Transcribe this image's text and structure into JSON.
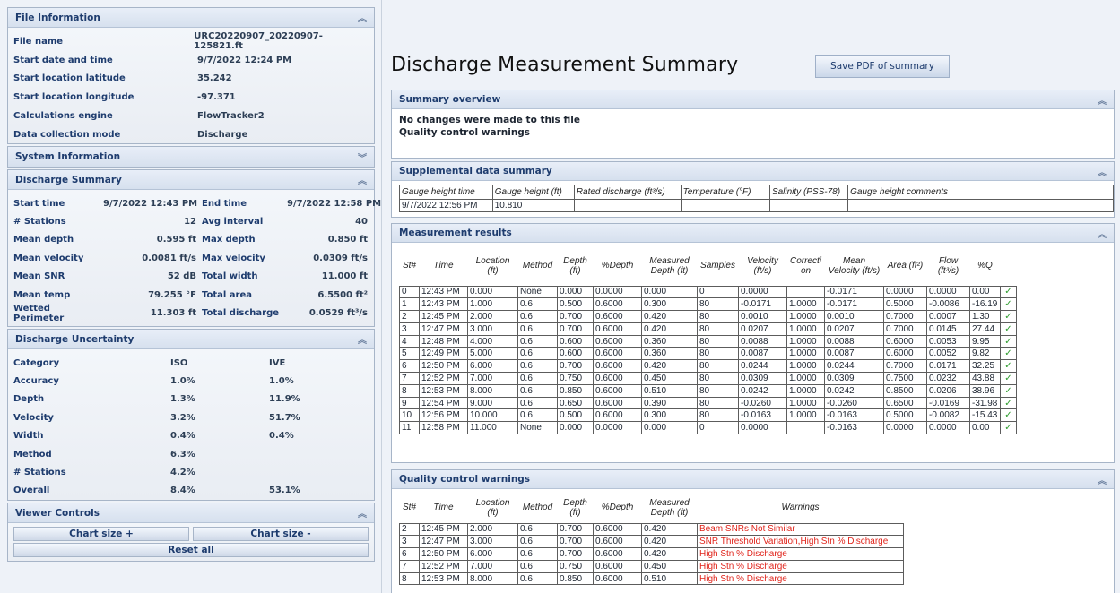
{
  "file_info": {
    "title": "File Information",
    "rows": [
      {
        "label": "File name",
        "value": "URC20220907_20220907-125821.ft"
      },
      {
        "label": "Start date and time",
        "value": "9/7/2022 12:24 PM"
      },
      {
        "label": "Start location latitude",
        "value": "35.242"
      },
      {
        "label": "Start location longitude",
        "value": "-97.371"
      },
      {
        "label": "Calculations engine",
        "value": "FlowTracker2"
      },
      {
        "label": "Data collection mode",
        "value": "Discharge"
      }
    ]
  },
  "system_info": {
    "title": "System Information"
  },
  "discharge_summary": {
    "title": "Discharge Summary",
    "rows": [
      {
        "l1": "Start time",
        "v1": "9/7/2022 12:43 PM",
        "l2": "End time",
        "v2": "9/7/2022 12:58 PM"
      },
      {
        "l1": "# Stations",
        "v1": "12",
        "l2": "Avg interval",
        "v2": "40"
      },
      {
        "l1": "Mean depth",
        "v1": "0.595  ft",
        "l2": "Max depth",
        "v2": "0.850  ft"
      },
      {
        "l1": "Mean velocity",
        "v1": "0.0081  ft/s",
        "l2": "Max velocity",
        "v2": "0.0309  ft/s"
      },
      {
        "l1": "Mean SNR",
        "v1": "52  dB",
        "l2": "Total width",
        "v2": "11.000  ft"
      },
      {
        "l1": "Mean temp",
        "v1": "79.255  °F",
        "l2": "Total area",
        "v2": "6.5500  ft²"
      },
      {
        "l1": "Wetted Perimeter",
        "v1": "11.303  ft",
        "l2": "Total discharge",
        "v2": "0.0529  ft³/s"
      }
    ]
  },
  "uncertainty": {
    "title": "Discharge Uncertainty",
    "header": {
      "c1": "Category",
      "c2": "ISO",
      "c3": "IVE"
    },
    "rows": [
      {
        "c1": "Accuracy",
        "c2": "1.0%",
        "c3": "1.0%"
      },
      {
        "c1": "Depth",
        "c2": "1.3%",
        "c3": "11.9%"
      },
      {
        "c1": "Velocity",
        "c2": "3.2%",
        "c3": "51.7%"
      },
      {
        "c1": "Width",
        "c2": "0.4%",
        "c3": "0.4%"
      },
      {
        "c1": "Method",
        "c2": "6.3%",
        "c3": ""
      },
      {
        "c1": "# Stations",
        "c2": "4.2%",
        "c3": ""
      },
      {
        "c1": "Overall",
        "c2": "8.4%",
        "c3": "53.1%"
      }
    ]
  },
  "viewer_controls": {
    "title": "Viewer Controls",
    "chart_size_plus": "Chart size +",
    "chart_size_minus": "Chart size -",
    "reset_all": "Reset all"
  },
  "main": {
    "title": "Discharge Measurement Summary",
    "save_pdf": "Save PDF of summary"
  },
  "summary_overview": {
    "title": "Summary overview",
    "lines": [
      "No changes were made to this file",
      "Quality control warnings"
    ]
  },
  "supplemental": {
    "title": "Supplemental data summary",
    "headers": [
      "Gauge height time",
      "Gauge height (ft)",
      "Rated discharge (ft³/s)",
      "Temperature (°F)",
      "Salinity (PSS-78)",
      "Gauge height comments"
    ],
    "row": [
      "9/7/2022 12:56 PM",
      "10.810",
      "",
      "",
      "",
      ""
    ]
  },
  "measurement": {
    "title": "Measurement results",
    "headers": [
      "St#",
      "Time",
      "Location (ft)",
      "Method",
      "Depth (ft)",
      "%Depth",
      "Measured Depth (ft)",
      "Samples",
      "Velocity (ft/s)",
      "Correcti on",
      "Mean Velocity (ft/s)",
      "Area (ft²)",
      "Flow (ft³/s)",
      "%Q"
    ],
    "check": "✓",
    "rows": [
      [
        "0",
        "12:43 PM",
        "0.000",
        "None",
        "0.000",
        "0.0000",
        "0.000",
        "0",
        "0.0000",
        "",
        "-0.0171",
        "0.0000",
        "0.0000",
        "0.00"
      ],
      [
        "1",
        "12:43 PM",
        "1.000",
        "0.6",
        "0.500",
        "0.6000",
        "0.300",
        "80",
        "-0.0171",
        "1.0000",
        "-0.0171",
        "0.5000",
        "-0.0086",
        "-16.19"
      ],
      [
        "2",
        "12:45 PM",
        "2.000",
        "0.6",
        "0.700",
        "0.6000",
        "0.420",
        "80",
        "0.0010",
        "1.0000",
        "0.0010",
        "0.7000",
        "0.0007",
        "1.30"
      ],
      [
        "3",
        "12:47 PM",
        "3.000",
        "0.6",
        "0.700",
        "0.6000",
        "0.420",
        "80",
        "0.0207",
        "1.0000",
        "0.0207",
        "0.7000",
        "0.0145",
        "27.44"
      ],
      [
        "4",
        "12:48 PM",
        "4.000",
        "0.6",
        "0.600",
        "0.6000",
        "0.360",
        "80",
        "0.0088",
        "1.0000",
        "0.0088",
        "0.6000",
        "0.0053",
        "9.95"
      ],
      [
        "5",
        "12:49 PM",
        "5.000",
        "0.6",
        "0.600",
        "0.6000",
        "0.360",
        "80",
        "0.0087",
        "1.0000",
        "0.0087",
        "0.6000",
        "0.0052",
        "9.82"
      ],
      [
        "6",
        "12:50 PM",
        "6.000",
        "0.6",
        "0.700",
        "0.6000",
        "0.420",
        "80",
        "0.0244",
        "1.0000",
        "0.0244",
        "0.7000",
        "0.0171",
        "32.25"
      ],
      [
        "7",
        "12:52 PM",
        "7.000",
        "0.6",
        "0.750",
        "0.6000",
        "0.450",
        "80",
        "0.0309",
        "1.0000",
        "0.0309",
        "0.7500",
        "0.0232",
        "43.88"
      ],
      [
        "8",
        "12:53 PM",
        "8.000",
        "0.6",
        "0.850",
        "0.6000",
        "0.510",
        "80",
        "0.0242",
        "1.0000",
        "0.0242",
        "0.8500",
        "0.0206",
        "38.96"
      ],
      [
        "9",
        "12:54 PM",
        "9.000",
        "0.6",
        "0.650",
        "0.6000",
        "0.390",
        "80",
        "-0.0260",
        "1.0000",
        "-0.0260",
        "0.6500",
        "-0.0169",
        "-31.98"
      ],
      [
        "10",
        "12:56 PM",
        "10.000",
        "0.6",
        "0.500",
        "0.6000",
        "0.300",
        "80",
        "-0.0163",
        "1.0000",
        "-0.0163",
        "0.5000",
        "-0.0082",
        "-15.43"
      ],
      [
        "11",
        "12:58 PM",
        "11.000",
        "None",
        "0.000",
        "0.0000",
        "0.000",
        "0",
        "0.0000",
        "",
        "-0.0163",
        "0.0000",
        "0.0000",
        "0.00"
      ]
    ]
  },
  "qc": {
    "title": "Quality control warnings",
    "headers": [
      "St#",
      "Time",
      "Location (ft)",
      "Method",
      "Depth (ft)",
      "%Depth",
      "Measured Depth (ft)",
      "Warnings"
    ],
    "rows": [
      [
        "2",
        "12:45 PM",
        "2.000",
        "0.6",
        "0.700",
        "0.6000",
        "0.420",
        "Beam SNRs Not Similar"
      ],
      [
        "3",
        "12:47 PM",
        "3.000",
        "0.6",
        "0.700",
        "0.6000",
        "0.420",
        "SNR Threshold Variation,High Stn % Discharge"
      ],
      [
        "6",
        "12:50 PM",
        "6.000",
        "0.6",
        "0.700",
        "0.6000",
        "0.420",
        "High Stn % Discharge"
      ],
      [
        "7",
        "12:52 PM",
        "7.000",
        "0.6",
        "0.750",
        "0.6000",
        "0.450",
        "High Stn % Discharge"
      ],
      [
        "8",
        "12:53 PM",
        "8.000",
        "0.6",
        "0.850",
        "0.6000",
        "0.510",
        "High Stn % Discharge"
      ]
    ]
  },
  "icons": {
    "collapse": "⌃",
    "expand": "⌄"
  },
  "colors": {
    "header_text": "#1e3c6e",
    "warning": "#e0241b",
    "check": "#2e9d2e"
  }
}
